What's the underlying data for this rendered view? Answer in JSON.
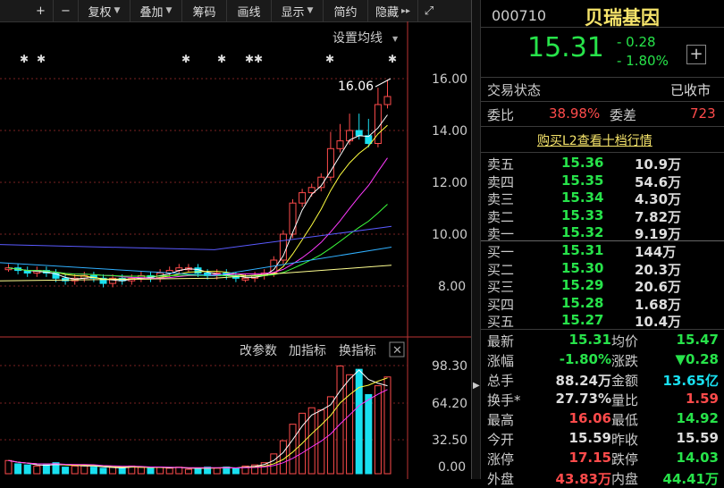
{
  "toolbar": {
    "items": [
      "+",
      "−",
      "复权",
      "叠加",
      "筹码",
      "画线",
      "显示",
      "简约",
      "隐藏"
    ],
    "hide_arrows": "▸▸",
    "settings_label": "设置均线"
  },
  "chart": {
    "price_ticks": [
      "16.00",
      "14.00",
      "12.00",
      "10.00",
      "8.00"
    ],
    "high_label": "16.06",
    "vol_ticks": [
      "98.30",
      "64.20",
      "32.50",
      "0.00"
    ],
    "vol_tabs": [
      "改参数",
      "加指标",
      "换指标"
    ],
    "colors": {
      "up": "#ff4b4b",
      "down": "#19e0f0",
      "ma5": "#ffffff",
      "ma10": "#ffff40",
      "ma20": "#ff3aff",
      "ma30": "#3cff3c",
      "ma60": "#5a5aff",
      "ma120": "#30b0ff",
      "ma250": "#ffff90"
    },
    "candles": [
      [
        0,
        1
      ],
      [
        1,
        0
      ],
      [
        2,
        0
      ],
      [
        3,
        1
      ],
      [
        4,
        0
      ],
      [
        5,
        0
      ],
      [
        6,
        1
      ],
      [
        7,
        0
      ],
      [
        8,
        1
      ],
      [
        9,
        1
      ],
      [
        10,
        0
      ],
      [
        11,
        1
      ],
      [
        12,
        0
      ],
      [
        13,
        1
      ],
      [
        14,
        1
      ],
      [
        15,
        0
      ],
      [
        16,
        1
      ],
      [
        17,
        0
      ],
      [
        18,
        0
      ],
      [
        19,
        1
      ],
      [
        20,
        1
      ],
      [
        21,
        0
      ],
      [
        22,
        1
      ],
      [
        23,
        1
      ],
      [
        24,
        0
      ],
      [
        25,
        1
      ],
      [
        26,
        1
      ],
      [
        27,
        0
      ],
      [
        28,
        1
      ],
      [
        29,
        0
      ],
      [
        30,
        0
      ],
      [
        31,
        1
      ],
      [
        32,
        1
      ],
      [
        33,
        0
      ],
      [
        34,
        1
      ],
      [
        35,
        0
      ],
      [
        36,
        1
      ],
      [
        37,
        1
      ],
      [
        38,
        1
      ],
      [
        39,
        0
      ],
      [
        40,
        1
      ]
    ]
  },
  "stock": {
    "code": "000710",
    "name": "贝瑞基因",
    "price": "15.31",
    "change": "- 0.28",
    "pct": "- 1.80%"
  },
  "status": {
    "label": "交易状态",
    "value": "已收市"
  },
  "weibi": {
    "label1": "委比",
    "value1": "38.98%",
    "label2": "委差",
    "value2": "723"
  },
  "l2_link": "购买L2查看十档行情",
  "asks": [
    {
      "label": "卖五",
      "price": "15.36",
      "vol": "10.9万"
    },
    {
      "label": "卖四",
      "price": "15.35",
      "vol": "54.6万"
    },
    {
      "label": "卖三",
      "price": "15.34",
      "vol": "4.30万"
    },
    {
      "label": "卖二",
      "price": "15.33",
      "vol": "7.82万"
    },
    {
      "label": "卖一",
      "price": "15.32",
      "vol": "9.19万"
    }
  ],
  "bids": [
    {
      "label": "买一",
      "price": "15.31",
      "vol": "144万"
    },
    {
      "label": "买二",
      "price": "15.30",
      "vol": "20.3万"
    },
    {
      "label": "买三",
      "price": "15.29",
      "vol": "20.6万"
    },
    {
      "label": "买四",
      "price": "15.28",
      "vol": "1.68万"
    },
    {
      "label": "买五",
      "price": "15.27",
      "vol": "10.4万"
    }
  ],
  "stats": [
    {
      "l1": "最新",
      "v1": "15.31",
      "c1": "g",
      "l2": "均价",
      "v2": "15.47",
      "c2": "g"
    },
    {
      "l1": "涨幅",
      "v1": "-1.80%",
      "c1": "g",
      "l2": "涨跌",
      "v2": "▼0.28",
      "c2": "g"
    },
    {
      "l1": "总手",
      "v1": "88.24万",
      "c1": "w",
      "l2": "金额",
      "v2": "13.65亿",
      "c2": "c"
    },
    {
      "l1": "换手*",
      "v1": "27.73%",
      "c1": "w",
      "l2": "量比",
      "v2": "1.59",
      "c2": "r"
    },
    {
      "l1": "最高",
      "v1": "16.06",
      "c1": "r",
      "l2": "最低",
      "v2": "14.92",
      "c2": "g"
    },
    {
      "l1": "今开",
      "v1": "15.59",
      "c1": "w",
      "l2": "昨收",
      "v2": "15.59",
      "c2": "w"
    },
    {
      "l1": "涨停",
      "v1": "17.15",
      "c1": "r",
      "l2": "跌停",
      "v2": "14.03",
      "c2": "g"
    },
    {
      "l1": "外盘",
      "v1": "43.83万",
      "c1": "r",
      "l2": "内盘",
      "v2": "44.41万",
      "c2": "g"
    }
  ]
}
